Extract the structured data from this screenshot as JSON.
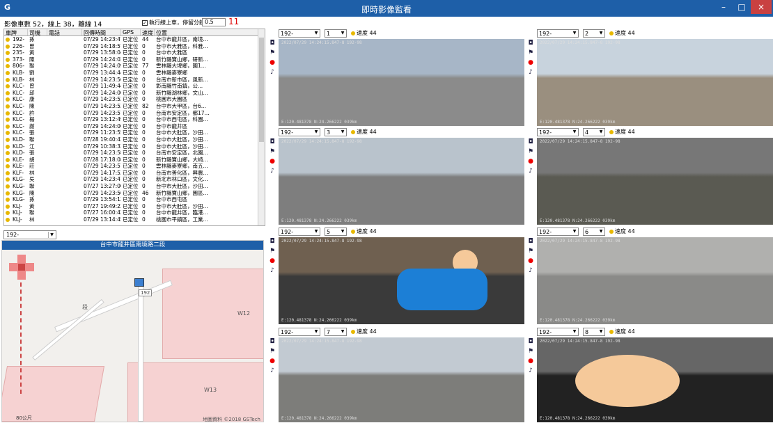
{
  "window": {
    "app_letter": "G",
    "title": "即時影像監看",
    "min": "–",
    "max": "□",
    "close": "×"
  },
  "status": {
    "summary": "影像車數 52，線上 38，離線 14",
    "checkbox_label": "執行線上車，停留分鐘：",
    "check_mark": "✓",
    "minutes_value": "0.5",
    "red_value": "11"
  },
  "list": {
    "headers": [
      "車牌",
      "司機",
      "電話",
      "回傳時間",
      "GPS",
      "速度",
      "位置"
    ],
    "rows": [
      [
        "192-",
        "孫",
        "",
        "07/29 14:23:47",
        "已定位",
        "44",
        "台中市龍井區，南境..."
      ],
      [
        "226-",
        "曾",
        "",
        "07/29 14:18:57",
        "已定位",
        "0",
        "台中市大雅區，科雅..."
      ],
      [
        "235-",
        "黃",
        "",
        "07/29 13:58:04",
        "已定位",
        "0",
        "台中市大雅區"
      ],
      [
        "373-",
        "陳",
        "",
        "07/29 14:24:02",
        "已定位",
        "0",
        "新竹縣寶山鄉，研新..."
      ],
      [
        "806-",
        "聯",
        "",
        "07/29 14:24:09",
        "已定位",
        "77",
        "雲林縣大埤鄉，園1..."
      ],
      [
        "KLB-",
        "劉",
        "",
        "07/29 13:44:44",
        "已定位",
        "0",
        "雲林縣麥寮鄉"
      ],
      [
        "KLB-",
        "林",
        "",
        "07/29 14:23:56",
        "已定位",
        "0",
        "台南市新市區，風新..."
      ],
      [
        "KLC-",
        "曾",
        "",
        "07/29 11:49:44",
        "已定位",
        "0",
        "彰南縣竹南鎮，公..."
      ],
      [
        "KLC-",
        "邱",
        "",
        "07/29 14:24:00",
        "已定位",
        "0",
        "新竹縣湖林鄉，文山..."
      ],
      [
        "KLC-",
        "康",
        "",
        "07/29 14:23:52",
        "已定位",
        "0",
        "桃園市大園區"
      ],
      [
        "KLC-",
        "陳",
        "",
        "07/29 14:23:53",
        "已定位",
        "82",
        "台中市大甲區，台6..."
      ],
      [
        "KLC-",
        "許",
        "",
        "07/29 14:23:57",
        "已定位",
        "0",
        "台南市安定區，鄉17..."
      ],
      [
        "KLC-",
        "楊",
        "",
        "07/29 13:12:49",
        "已定位",
        "0",
        "台中市西屯區，科園..."
      ],
      [
        "KLC-",
        "謝",
        "",
        "07/29 14:24:00",
        "已定位",
        "0",
        "台中市龍井區"
      ],
      [
        "KLC-",
        "張",
        "",
        "07/29 11:23:55",
        "已定位",
        "0",
        "台中市大肚區，沙田..."
      ],
      [
        "KLD-",
        "聯",
        "",
        "07/28 19:40:43",
        "已定位",
        "0",
        "台中市大肚區，沙田..."
      ],
      [
        "KLD-",
        "江",
        "",
        "07/29 10:38:33",
        "已定位",
        "0",
        "台中市大肚區，沙田..."
      ],
      [
        "KLD-",
        "張",
        "",
        "07/29 14:23:58",
        "已定位",
        "0",
        "台南市安定區，北園..."
      ],
      [
        "KLE-",
        "胡",
        "",
        "07/28 17:18:08",
        "已定位",
        "0",
        "新竹縣寶山鄉，大崎..."
      ],
      [
        "KLE-",
        "莊",
        "",
        "07/29 14:23:57",
        "已定位",
        "0",
        "雲林縣麥寮鄉，南五..."
      ],
      [
        "KLF-",
        "林",
        "",
        "07/29 14:17:53",
        "已定位",
        "0",
        "台南市善化區，興農..."
      ],
      [
        "KLG-",
        "吳",
        "",
        "07/29 14:23:47",
        "已定位",
        "0",
        "新北市林口區，文化..."
      ],
      [
        "KLG-",
        "聯",
        "",
        "07/27 13:27:00",
        "已定位",
        "0",
        "台中市大肚區，沙田..."
      ],
      [
        "KLG-",
        "陳",
        "",
        "07/29 14:23:56",
        "已定位",
        "46",
        "新竹縣寶山鄉，園區..."
      ],
      [
        "KLG-",
        "孫",
        "",
        "07/29 13:54:13",
        "已定位",
        "0",
        "台中市西屯區"
      ],
      [
        "KLJ-",
        "黃",
        "",
        "07/27 19:49:23",
        "已定位",
        "0",
        "台中市大肚區，沙田..."
      ],
      [
        "KLJ-",
        "聯",
        "",
        "07/27 16:00:42",
        "已定位",
        "0",
        "台中市龍井區，臨港..."
      ],
      [
        "KLJ-",
        "林",
        "",
        "07/29 13:14:45",
        "已定位",
        "0",
        "桃園市平鎮區，工業..."
      ]
    ]
  },
  "map": {
    "selector": "192-",
    "address": "台中市龍井區南境路二段",
    "labels": {
      "w12": "W12",
      "w13": "W13",
      "road": "段"
    },
    "car_tag": "192",
    "scale": "80公尺",
    "copyright": "地圖資料 ©2018 GSTech"
  },
  "feeds": [
    {
      "plate": "192-",
      "channel": "1",
      "speed": "速度 44",
      "osd": "2022/07/29 14:24:15.847-8 192-98",
      "osd_bottom": "E:120.481378 N:24.266222  039km"
    },
    {
      "plate": "192-",
      "channel": "2",
      "speed": "速度 44",
      "osd": "2022/07/29 14:24:15.847-8 192-98",
      "osd_bottom": "E:120.481378 N:24.266222  039km"
    },
    {
      "plate": "192-",
      "channel": "3",
      "speed": "速度 44",
      "osd": "2022/07/29 14:24:15.847-8 192-98",
      "osd_bottom": "E:120.481378 N:24.266222  039km"
    },
    {
      "plate": "192-",
      "channel": "4",
      "speed": "速度 44",
      "osd": "2022/07/29 14:24:15.847-8 192-98",
      "osd_bottom": "E:120.481378 N:24.266222  039km"
    },
    {
      "plate": "192-",
      "channel": "5",
      "speed": "速度 44",
      "osd": "2022/07/29 14:24:15.847-8 192-98",
      "osd_bottom": "E:120.481378 N:24.266222  039km"
    },
    {
      "plate": "192-",
      "channel": "6",
      "speed": "速度 44",
      "osd": "2022/07/29 14:24:15.847-8 192-98",
      "osd_bottom": "E:120.481378 N:24.266222  039km"
    },
    {
      "plate": "192-",
      "channel": "7",
      "speed": "速度 44",
      "osd": "2022/07/29 14:24:15.847-8 192-98",
      "osd_bottom": "E:120.481378 N:24.266222  039km"
    },
    {
      "plate": "192-",
      "channel": "8",
      "speed": "速度 44",
      "osd": "2022/07/29 14:24:15.847-8 192-98",
      "osd_bottom": "E:120.481378 N:24.266222  039km"
    }
  ],
  "icons": {
    "snapshot": "camera-icon",
    "talk": "microphone-icon",
    "record": "record-icon",
    "audio": "speaker-icon",
    "pan": "pan-control-icon",
    "vehicle": "truck-icon"
  }
}
